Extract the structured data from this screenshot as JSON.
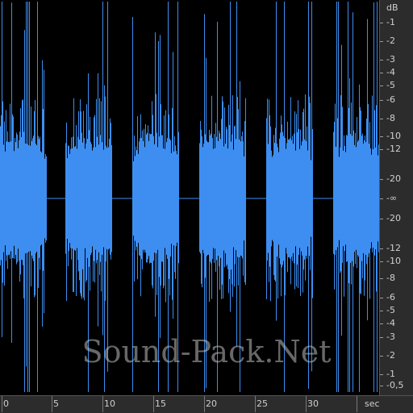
{
  "colors": {
    "waveform": "#3d8ef0",
    "background": "#000000",
    "ruler_bg": "#2c2c2c",
    "ruler_text": "#cfcfcf"
  },
  "waveform": {
    "channel_label": "",
    "burst_count": 6,
    "burst_time_ranges_sec": [
      [
        0,
        4.6
      ],
      [
        6.4,
        11.0
      ],
      [
        13.0,
        17.6
      ],
      [
        19.6,
        24.2
      ],
      [
        26.2,
        30.8
      ],
      [
        32.8,
        37.6
      ]
    ],
    "silence_level": "-∞"
  },
  "db_ruler": {
    "unit": "dB",
    "labels": [
      "-1",
      "-2",
      "-3",
      "-4",
      "-5",
      "-6",
      "-8",
      "-10",
      "-12",
      "-20",
      "-∞",
      "-20",
      "-12",
      "-10",
      "-8",
      "-6",
      "-5",
      "-4",
      "-3",
      "-2",
      "-1",
      "-0,5"
    ]
  },
  "time_ruler": {
    "unit": "sec",
    "labels": [
      "0",
      "5",
      "10",
      "15",
      "20",
      "25",
      "30"
    ]
  },
  "watermark": "Sound-Pack.Net"
}
